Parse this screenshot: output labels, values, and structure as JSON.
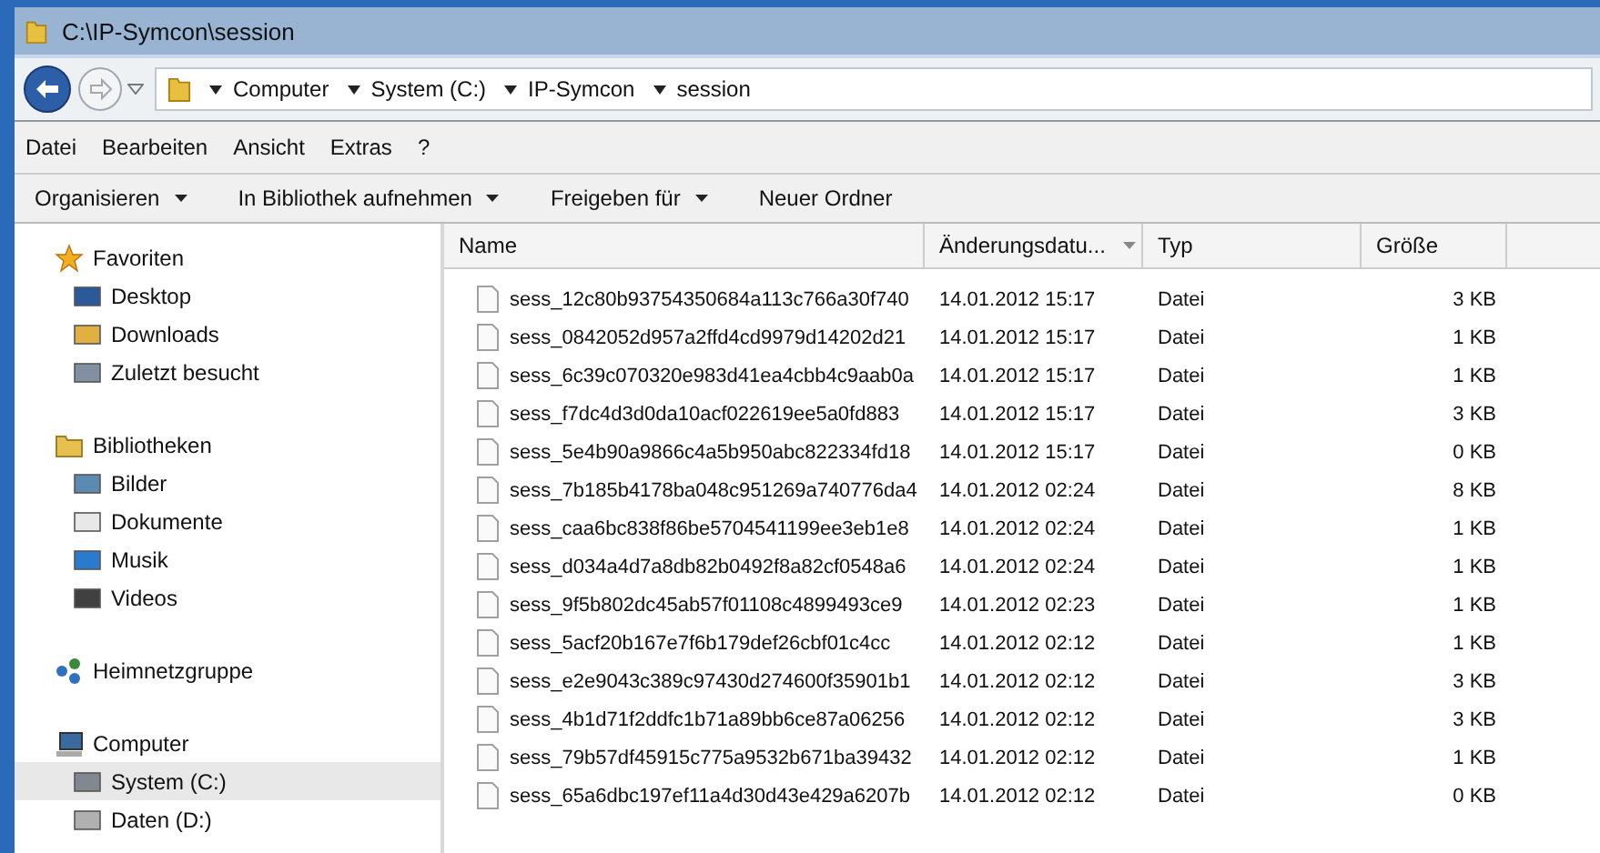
{
  "window": {
    "title": "C:\\IP-Symcon\\session"
  },
  "address_bar": {
    "segments": [
      "Computer",
      "System (C:)",
      "IP-Symcon",
      "session"
    ]
  },
  "menu": [
    "Datei",
    "Bearbeiten",
    "Ansicht",
    "Extras",
    "?"
  ],
  "toolbar": [
    {
      "label": "Organisieren",
      "dropdown": true
    },
    {
      "label": "In Bibliothek aufnehmen",
      "dropdown": true
    },
    {
      "label": "Freigeben für",
      "dropdown": true
    },
    {
      "label": "Neuer Ordner",
      "dropdown": false
    }
  ],
  "sidebar": {
    "groups": [
      {
        "label": "Favoriten",
        "children": [
          {
            "label": "Desktop",
            "selected": false
          },
          {
            "label": "Downloads",
            "selected": false
          },
          {
            "label": "Zuletzt besucht",
            "selected": false
          }
        ]
      },
      {
        "label": "Bibliotheken",
        "children": [
          {
            "label": "Bilder",
            "selected": false
          },
          {
            "label": "Dokumente",
            "selected": false
          },
          {
            "label": "Musik",
            "selected": false
          },
          {
            "label": "Videos",
            "selected": false
          }
        ]
      },
      {
        "label": "Heimnetzgruppe"
      },
      {
        "label": "Computer",
        "children": [
          {
            "label": "System (C:)",
            "selected": true
          },
          {
            "label": "Daten (D:)",
            "selected": false
          }
        ]
      }
    ]
  },
  "table": {
    "columns": [
      {
        "label": "Name",
        "sorted": false
      },
      {
        "label": "Änderungsdatu...",
        "sorted": true
      },
      {
        "label": "Typ",
        "sorted": false
      },
      {
        "label": "Größe",
        "sorted": false
      }
    ],
    "rows": [
      {
        "name": "sess_12c80b93754350684a113c766a30f740",
        "date": "14.01.2012 15:17",
        "type": "Datei",
        "size": "3 KB"
      },
      {
        "name": "sess_0842052d957a2ffd4cd9979d14202d21",
        "date": "14.01.2012 15:17",
        "type": "Datei",
        "size": "1 KB"
      },
      {
        "name": "sess_6c39c070320e983d41ea4cbb4c9aab0a",
        "date": "14.01.2012 15:17",
        "type": "Datei",
        "size": "1 KB"
      },
      {
        "name": "sess_f7dc4d3d0da10acf022619ee5a0fd883",
        "date": "14.01.2012 15:17",
        "type": "Datei",
        "size": "3 KB"
      },
      {
        "name": "sess_5e4b90a9866c4a5b950abc822334fd18",
        "date": "14.01.2012 15:17",
        "type": "Datei",
        "size": "0 KB"
      },
      {
        "name": "sess_7b185b4178ba048c951269a740776da4",
        "date": "14.01.2012 02:24",
        "type": "Datei",
        "size": "8 KB"
      },
      {
        "name": "sess_caa6bc838f86be5704541199ee3eb1e8",
        "date": "14.01.2012 02:24",
        "type": "Datei",
        "size": "1 KB"
      },
      {
        "name": "sess_d034a4d7a8db82b0492f8a82cf0548a6",
        "date": "14.01.2012 02:24",
        "type": "Datei",
        "size": "1 KB"
      },
      {
        "name": "sess_9f5b802dc45ab57f01108c4899493ce9",
        "date": "14.01.2012 02:23",
        "type": "Datei",
        "size": "1 KB"
      },
      {
        "name": "sess_5acf20b167e7f6b179def26cbf01c4cc",
        "date": "14.01.2012 02:12",
        "type": "Datei",
        "size": "1 KB"
      },
      {
        "name": "sess_e2e9043c389c97430d274600f35901b1",
        "date": "14.01.2012 02:12",
        "type": "Datei",
        "size": "3 KB"
      },
      {
        "name": "sess_4b1d71f2ddfc1b71a89bb6ce87a06256",
        "date": "14.01.2012 02:12",
        "type": "Datei",
        "size": "3 KB"
      },
      {
        "name": "sess_79b57df45915c775a9532b671ba39432",
        "date": "14.01.2012 02:12",
        "type": "Datei",
        "size": "1 KB"
      },
      {
        "name": "sess_65a6dbc197ef11a4d30d43e429a6207b",
        "date": "14.01.2012 02:12",
        "type": "Datei",
        "size": "0 KB"
      }
    ]
  }
}
